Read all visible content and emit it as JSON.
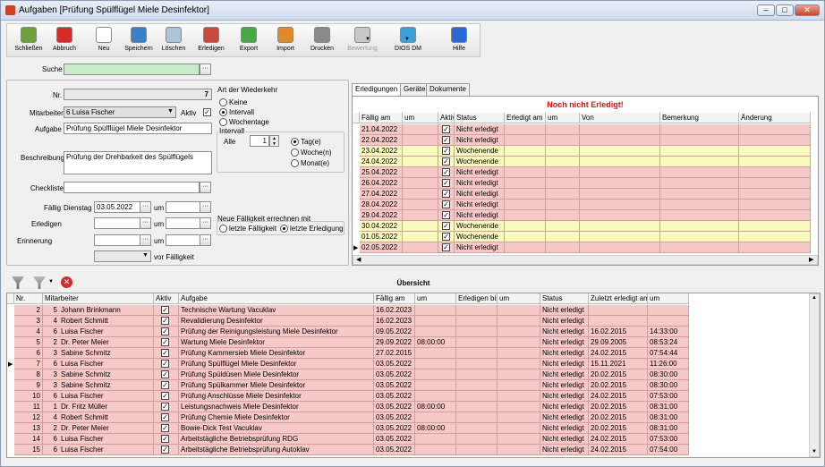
{
  "window": {
    "title": "Aufgaben [Prüfung Spülflügel Miele Desinfektor]",
    "app_icon": "wrench-icon",
    "minimize": "–",
    "maximize": "□",
    "close": "✕"
  },
  "toolbar": [
    {
      "label": "Schließen",
      "icon": "exit-door-icon",
      "color": "#6aa33a"
    },
    {
      "label": "Abbruch",
      "icon": "cancel-icon",
      "color": "#d62b2b"
    },
    {
      "label": "Neu",
      "icon": "new-document-icon",
      "color": "#ffffff"
    },
    {
      "label": "Speichern",
      "icon": "save-icon",
      "color": "#3a7fc8"
    },
    {
      "label": "Löschen",
      "icon": "delete-icon",
      "color": "#b0c4d8"
    },
    {
      "label": "Erledigen",
      "icon": "complete-icon",
      "color": "#c84a3a"
    },
    {
      "label": "Export",
      "icon": "export-icon",
      "color": "#48a848"
    },
    {
      "label": "Import",
      "icon": "import-icon",
      "color": "#e08a2a"
    },
    {
      "label": "Drucken",
      "icon": "printer-icon",
      "color": "#8a8a8a"
    },
    {
      "label": "Bewertung",
      "icon": "rating-icon",
      "color": "#c8c8c8"
    },
    {
      "label": "DIOS DM",
      "icon": "dios-dm-icon",
      "color": "#3aa0d8"
    },
    {
      "label": "Hilfe",
      "icon": "help-icon",
      "color": "#2a6ad8"
    }
  ],
  "search": {
    "label": "Suche",
    "value": ""
  },
  "form": {
    "nr_label": "Nr.",
    "nr_value": "7",
    "mitarbeiter_label": "Mitarbeiter",
    "mitarbeiter_value": "6   Luisa Fischer",
    "aktiv_label": "Aktiv",
    "aufgabe_label": "Aufgabe",
    "aufgabe_value": "Prüfung Spülflügel Miele Desinfektor",
    "beschreibung_label": "Beschreibung",
    "beschreibung_value": "Prüfung der Drehbarkeit des Spülflügels",
    "checkliste_label": "Checkliste",
    "checkliste_value": "",
    "faellig_label": "Fällig",
    "faellig_day": "Dienstag",
    "faellig_date": "03.05.2022",
    "um_label": "um",
    "erledigen_label": "Erledigen",
    "erinnerung_label": "Erinnerung",
    "vor_faelligkeit": "vor Fälligkeit"
  },
  "wiederkehr": {
    "title": "Art der Wiederkehr",
    "options": [
      "Keine",
      "Intervall",
      "Wochentage"
    ],
    "selected": 1,
    "intervall_title": "Intervall",
    "alle_label": "Alle",
    "alle_value": "1",
    "units": [
      "Tag(e)",
      "Woche(n)",
      "Monat(e)"
    ],
    "unit_selected": 0
  },
  "neu_faelligkeit": {
    "title": "Neue Fälligkeit errechnen mit",
    "options": [
      "letzte Fälligkeit",
      "letzte Erledigung"
    ],
    "selected": 1
  },
  "tabs": [
    "Erledigungen",
    "Geräte",
    "Dokumente"
  ],
  "erledigungen": {
    "status_header": "Noch nicht Erledigt!",
    "columns": [
      "Fällig am",
      "um",
      "Aktiv",
      "Status",
      "Erledigt am",
      "um",
      "Von",
      "Bemerkung",
      "Änderung"
    ],
    "rows": [
      {
        "date": "21.04.2022",
        "status": "Nicht erledigt",
        "kind": "pink"
      },
      {
        "date": "22.04.2022",
        "status": "Nicht erledigt",
        "kind": "pink"
      },
      {
        "date": "23.04.2022",
        "status": "Wochenende",
        "kind": "yellow"
      },
      {
        "date": "24.04.2022",
        "status": "Wochenende",
        "kind": "yellow"
      },
      {
        "date": "25.04.2022",
        "status": "Nicht erledigt",
        "kind": "pink"
      },
      {
        "date": "26.04.2022",
        "status": "Nicht erledigt",
        "kind": "pink"
      },
      {
        "date": "27.04.2022",
        "status": "Nicht erledigt",
        "kind": "pink"
      },
      {
        "date": "28.04.2022",
        "status": "Nicht erledigt",
        "kind": "pink"
      },
      {
        "date": "29.04.2022",
        "status": "Nicht erledigt",
        "kind": "pink"
      },
      {
        "date": "30.04.2022",
        "status": "Wochenende",
        "kind": "yellow"
      },
      {
        "date": "01.05.2022",
        "status": "Wochenende",
        "kind": "yellow"
      },
      {
        "date": "02.05.2022",
        "status": "Nicht erledigt",
        "kind": "pink"
      }
    ]
  },
  "overview": {
    "title": "Übersicht",
    "columns": [
      "Nr.",
      "Mitarbeiter",
      "Aktiv",
      "Aufgabe",
      "Fällig am",
      "um",
      "Erledigen bis",
      "um",
      "Status",
      "Zuletzt erledigt am",
      "um"
    ],
    "rows": [
      {
        "nr": "2",
        "mnr": "5",
        "name": "Johann Brinkmann",
        "aufgabe": "Technische Wartung Vacuklav",
        "faellig": "16.02.2023",
        "um": "",
        "status": "Nicht erledigt",
        "zuletzt": "",
        "zum": ""
      },
      {
        "nr": "3",
        "mnr": "4",
        "name": "Robert Schmitt",
        "aufgabe": "Revalidierung Desinfektor",
        "faellig": "16.02.2023",
        "um": "",
        "status": "Nicht erledigt",
        "zuletzt": "",
        "zum": ""
      },
      {
        "nr": "4",
        "mnr": "6",
        "name": "Luisa Fischer",
        "aufgabe": "Prüfung der Reinigungsleistung Miele Desinfektor",
        "faellig": "09.05.2022",
        "um": "",
        "status": "Nicht erledigt",
        "zuletzt": "16.02.2015",
        "zum": "14:33:00"
      },
      {
        "nr": "5",
        "mnr": "2",
        "name": "Dr. Peter Meier",
        "aufgabe": "Wartung Miele Desinfektor",
        "faellig": "29.09.2022",
        "um": "08:00:00",
        "status": "Nicht erledigt",
        "zuletzt": "29.09.2005",
        "zum": "08:53:24"
      },
      {
        "nr": "6",
        "mnr": "3",
        "name": "Sabine Schmitz",
        "aufgabe": "Prüfung Kammersieb Miele Desinfektor",
        "faellig": "27.02.2015",
        "um": "",
        "status": "Nicht erledigt",
        "zuletzt": "24.02.2015",
        "zum": "07:54:44"
      },
      {
        "nr": "7",
        "mnr": "6",
        "name": "Luisa Fischer",
        "aufgabe": "Prüfung Spülflügel Miele Desinfektor",
        "faellig": "03.05.2022",
        "um": "",
        "status": "Nicht erledigt",
        "zuletzt": "15.11.2021",
        "zum": "11:26:00"
      },
      {
        "nr": "8",
        "mnr": "3",
        "name": "Sabine Schmitz",
        "aufgabe": "Prüfung Spüldüsen Miele Desinfektor",
        "faellig": "03.05.2022",
        "um": "",
        "status": "Nicht erledigt",
        "zuletzt": "20.02.2015",
        "zum": "08:30:00"
      },
      {
        "nr": "9",
        "mnr": "3",
        "name": "Sabine Schmitz",
        "aufgabe": "Prüfung Spülkammer Miele Desinfektor",
        "faellig": "03.05.2022",
        "um": "",
        "status": "Nicht erledigt",
        "zuletzt": "20.02.2015",
        "zum": "08:30:00"
      },
      {
        "nr": "10",
        "mnr": "6",
        "name": "Luisa Fischer",
        "aufgabe": "Prüfung Anschlüsse Miele Desinfektor",
        "faellig": "03.05.2022",
        "um": "",
        "status": "Nicht erledigt",
        "zuletzt": "24.02.2015",
        "zum": "07:53:00"
      },
      {
        "nr": "11",
        "mnr": "1",
        "name": "Dr. Fritz Müller",
        "aufgabe": "Leistungsnachweis Miele Desinfektor",
        "faellig": "03.05.2022",
        "um": "08:00:00",
        "status": "Nicht erledigt",
        "zuletzt": "20.02.2015",
        "zum": "08:31:00"
      },
      {
        "nr": "12",
        "mnr": "4",
        "name": "Robert Schmitt",
        "aufgabe": "Prüfung Chemie Miele Desinfektor",
        "faellig": "03.05.2022",
        "um": "",
        "status": "Nicht erledigt",
        "zuletzt": "20.02.2015",
        "zum": "08:31:00"
      },
      {
        "nr": "13",
        "mnr": "2",
        "name": "Dr. Peter Meier",
        "aufgabe": "Bowie-Dick Test Vacuklav",
        "faellig": "03.05.2022",
        "um": "08:00:00",
        "status": "Nicht erledigt",
        "zuletzt": "20.02.2015",
        "zum": "08:31:00"
      },
      {
        "nr": "14",
        "mnr": "6",
        "name": "Luisa Fischer",
        "aufgabe": "Arbeitstägliche Betriebsprüfung RDG",
        "faellig": "03.05.2022",
        "um": "",
        "status": "Nicht erledigt",
        "zuletzt": "24.02.2015",
        "zum": "07:53:00"
      },
      {
        "nr": "15",
        "mnr": "6",
        "name": "Luisa Fischer",
        "aufgabe": "Arbeitstägliche Betriebsprüfung Autoklav",
        "faellig": "03.05.2022",
        "um": "",
        "status": "Nicht erledigt",
        "zuletzt": "24.02.2015",
        "zum": "07:54:00"
      }
    ]
  },
  "colors": {
    "pink": "#f6c8c8",
    "yellow": "#fafac0",
    "alert": "#e01010"
  }
}
